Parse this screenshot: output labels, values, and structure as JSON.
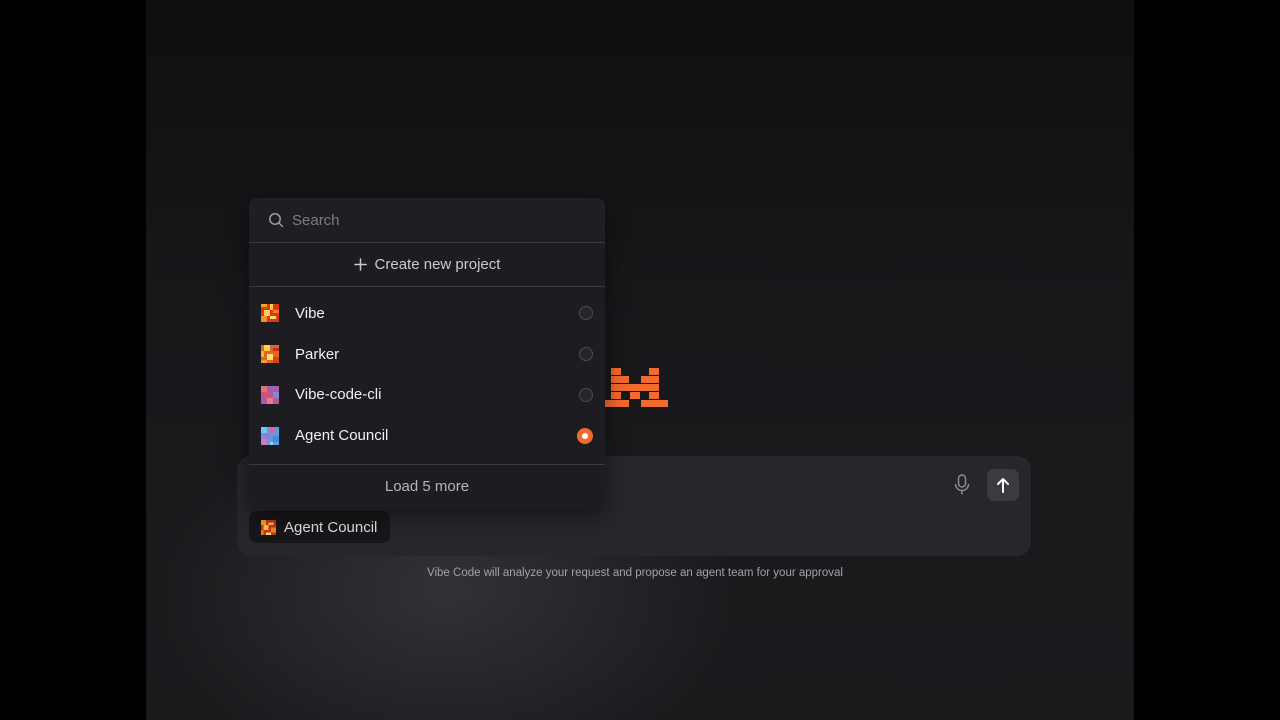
{
  "search": {
    "placeholder": "Search"
  },
  "project_menu": {
    "create_label": "Create new project",
    "items": [
      {
        "label": "Vibe",
        "avatar": "avatar-orange",
        "selected": false
      },
      {
        "label": "Parker",
        "avatar": "avatar-amber",
        "selected": false
      },
      {
        "label": "Vibe-code-cli",
        "avatar": "avatar-purple",
        "selected": false
      },
      {
        "label": "Agent Council",
        "avatar": "avatar-blue",
        "selected": true
      }
    ],
    "load_more_label": "Load 5 more"
  },
  "composer": {
    "selected_project": "Agent Council",
    "hint": "Vibe Code will analyze your request and propose an agent team for your approval"
  },
  "colors": {
    "accent": "#f26a2e",
    "background": "#18181b",
    "panel": "#1d1d21"
  }
}
